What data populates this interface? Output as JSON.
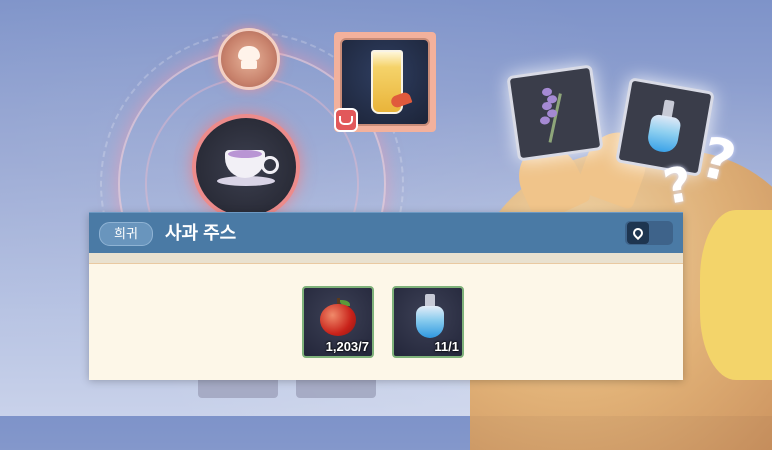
{
  "tooltip": {
    "rarity_label": "희귀",
    "item_name": "사과 주스",
    "ingredients": [
      {
        "icon": "apple-icon",
        "count": "1,203/7"
      },
      {
        "icon": "potion-icon",
        "count": "11/1"
      }
    ]
  },
  "colors": {
    "header_bg": "#4a7aa5",
    "body_bg": "#fdf7e8",
    "slot_border": "#7fb27a",
    "selected_frame": "#f3b19c"
  },
  "background": {
    "question_marks": [
      "?",
      "?"
    ]
  }
}
